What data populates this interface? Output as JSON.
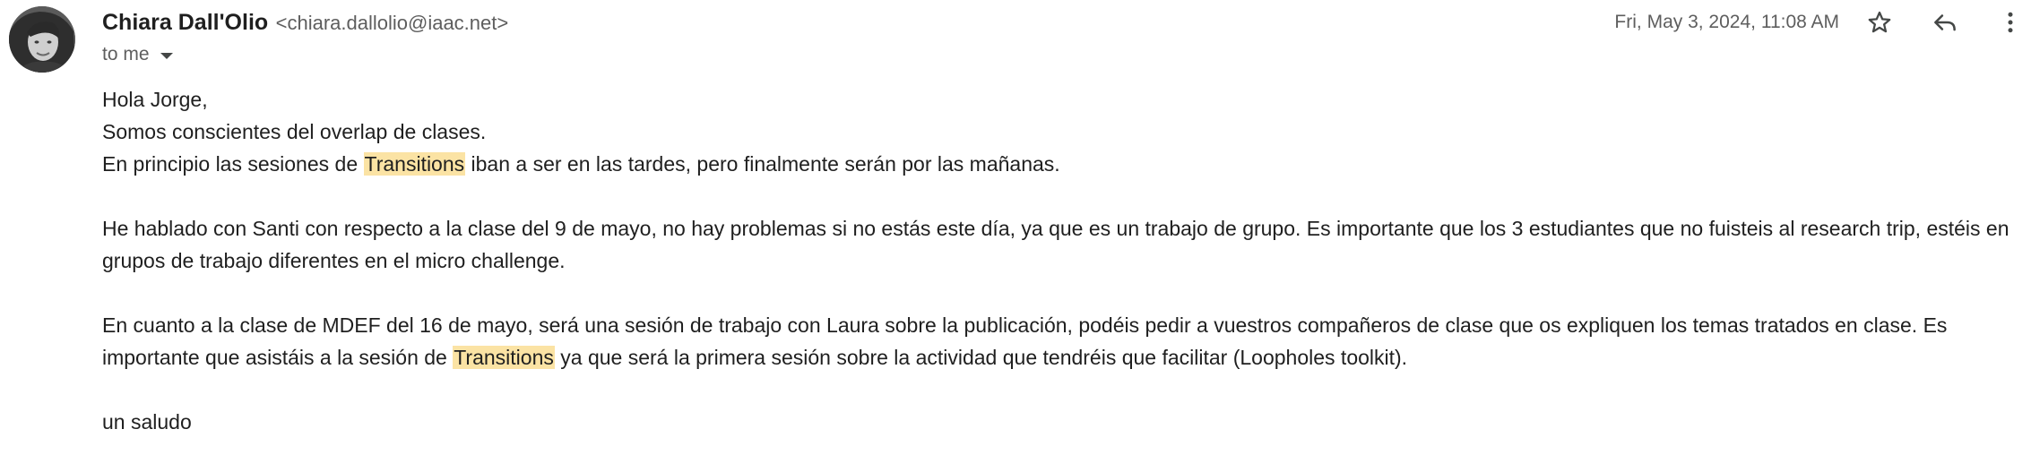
{
  "sender": {
    "name": "Chiara Dall'Olio",
    "email": "<chiara.dallolio@iaac.net>"
  },
  "recipient": "to me",
  "date": "Fri, May 3, 2024, 11:08 AM",
  "icons": {
    "star": "star-icon",
    "reply": "reply-icon",
    "more": "more-vert-icon",
    "caret": "chevron-down-icon"
  },
  "highlight_color": "#fbe3a4",
  "body": {
    "greeting": "Hola Jorge,",
    "line1": "Somos conscientes del overlap de clases.",
    "line2_pre": "En principio las sesiones de ",
    "line2_hl": "Transitions",
    "line2_post": " iban a ser en las tardes, pero finalmente serán por las mañanas.",
    "para2": "He hablado con Santi con respecto a la clase del 9 de mayo, no hay problemas si no estás este día, ya que es un trabajo de grupo. Es importante que los 3 estudiantes que no fuisteis al research trip, estéis en grupos de trabajo diferentes en el micro challenge.",
    "para3_pre": "En cuanto a la clase de MDEF del 16 de mayo, será una sesión de trabajo con Laura sobre la publicación, podéis pedir a vuestros compañeros de clase que os expliquen los temas tratados en clase. Es importante que asistáis a la sesión de ",
    "para3_hl": "Transitions",
    "para3_post": " ya que será la primera sesión sobre la actividad que tendréis que facilitar (Loopholes toolkit).",
    "closing": "un saludo"
  }
}
